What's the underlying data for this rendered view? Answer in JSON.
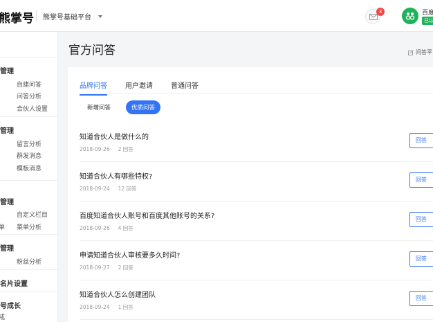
{
  "header": {
    "logo": "熊掌号",
    "platform_switch": "熊掌号基础平台",
    "mail_count": "3",
    "user_name": "百度",
    "user_tag": "已认"
  },
  "sidebar": {
    "groups": [
      {
        "title": "管理",
        "items": [
          "自建问答",
          "问答分析",
          "合伙人设置"
        ]
      },
      {
        "title": "管理",
        "items": [
          "留言分析",
          "群发消息",
          "模板消息"
        ]
      },
      {
        "title": "管理",
        "items": [
          "自定义栏目",
          "菜单分析"
        ],
        "edge_label": "单"
      },
      {
        "title": "管理",
        "items": [
          "粉丝分析"
        ]
      },
      {
        "title": "名片设置",
        "items": []
      },
      {
        "title": "号成长",
        "items": [],
        "edge_label": "戒"
      }
    ]
  },
  "main": {
    "page_title": "官方问答",
    "help_link": "问答平",
    "tabs": [
      {
        "label": "品牌问答",
        "active": true
      },
      {
        "label": "用户邀请",
        "active": false
      },
      {
        "label": "普通问答",
        "active": false
      }
    ],
    "subtabs": [
      {
        "label": "新增问答",
        "active": false
      },
      {
        "label": "优质问答",
        "active": true
      }
    ],
    "reply_label": "回答",
    "questions": [
      {
        "title": "知道合伙人是做什么的",
        "date": "2018-09-26",
        "answers": "2 回答"
      },
      {
        "title": "知道合伙人有哪些特权?",
        "date": "2018-09-24",
        "answers": "12 回答"
      },
      {
        "title": "百度知道合伙人账号和百度其他账号的关系?",
        "date": "2018-09-26",
        "answers": "4 回答"
      },
      {
        "title": "申请知道合伙人审核要多久时间?",
        "date": "2018-09-27",
        "answers": "2 回答"
      },
      {
        "title": "知道合伙人怎么创建团队",
        "date": "2018-09-24",
        "answers": "1 回答"
      }
    ]
  },
  "colors": {
    "accent": "#3374f6",
    "badge": "#f04848",
    "avatar": "#1fb25a"
  }
}
